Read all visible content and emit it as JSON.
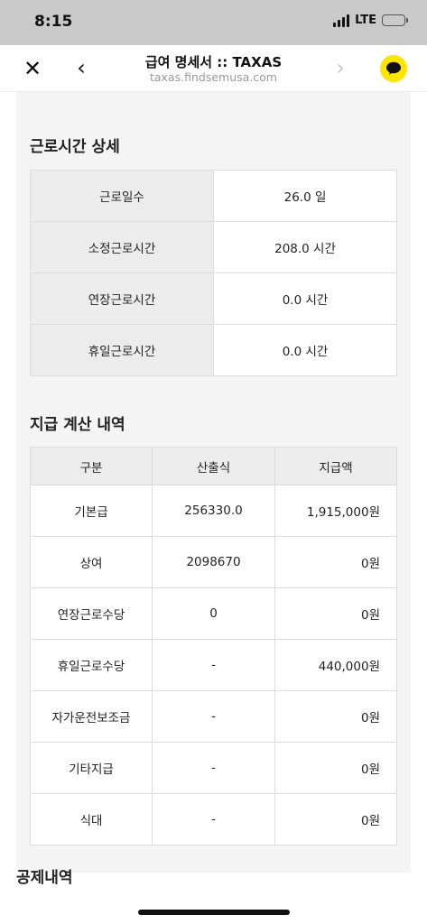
{
  "status": {
    "time": "8:15",
    "network": "LTE"
  },
  "nav": {
    "title": "급여 명세서 :: TAXAS",
    "url": "taxas.findsemusa.com"
  },
  "work_hours": {
    "title": "근로시간 상세",
    "rows": [
      {
        "label": "근로일수",
        "value": "26.0 일"
      },
      {
        "label": "소정근로시간",
        "value": "208.0 시간"
      },
      {
        "label": "연장근로시간",
        "value": "0.0 시간"
      },
      {
        "label": "휴일근로시간",
        "value": "0.0 시간"
      }
    ]
  },
  "payment": {
    "title": "지급 계산 내역",
    "headers": [
      "구분",
      "산출식",
      "지급액"
    ],
    "rows": [
      {
        "item": "기본급",
        "formula": "256330.0",
        "amount": "1,915,000원"
      },
      {
        "item": "상여",
        "formula": "2098670",
        "amount": "0원"
      },
      {
        "item": "연장근로수당",
        "formula": "0",
        "amount": "0원"
      },
      {
        "item": "휴일근로수당",
        "formula": "-",
        "amount": "440,000원"
      },
      {
        "item": "자가운전보조금",
        "formula": "-",
        "amount": "0원"
      },
      {
        "item": "기타지급",
        "formula": "-",
        "amount": "0원"
      },
      {
        "item": "식대",
        "formula": "-",
        "amount": "0원"
      }
    ]
  },
  "deduction": {
    "title": "공제내역"
  }
}
